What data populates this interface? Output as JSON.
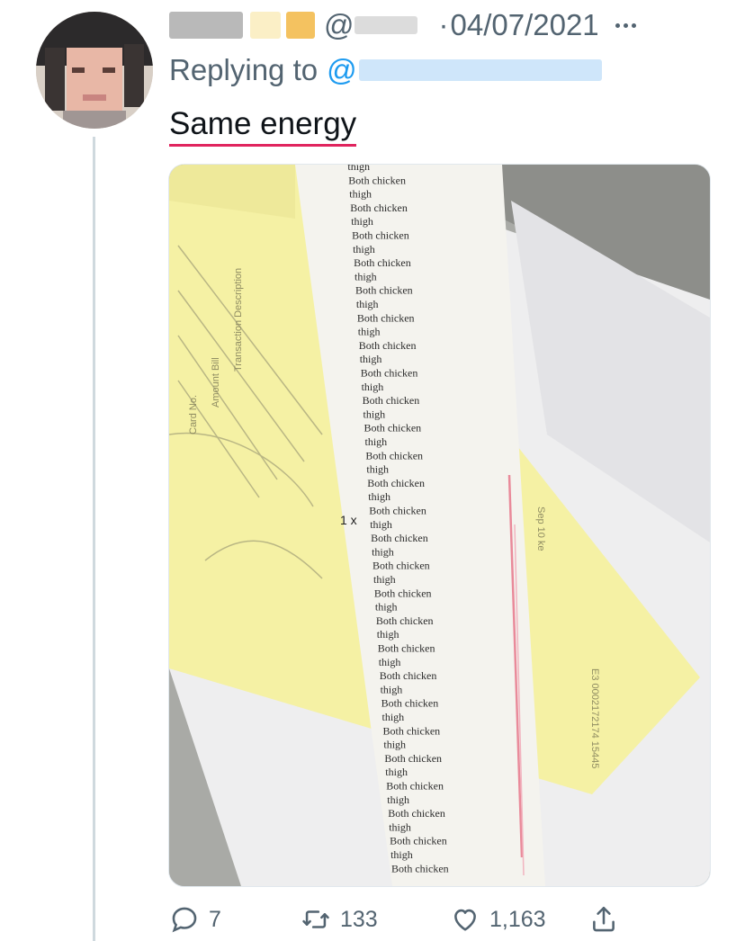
{
  "tweet": {
    "handle_prefix": "@",
    "separator": "·",
    "date": "04/07/2021",
    "replying_to_label": "Replying to",
    "mention_prefix": "@",
    "text": "Same energy"
  },
  "media": {
    "receipt_qty": "1 x",
    "receipt_line_a": "Both chicken",
    "receipt_line_b": "thigh"
  },
  "actions": {
    "reply_count": "7",
    "retweet_count": "133",
    "like_count": "1,163"
  },
  "colors": {
    "text_primary": "#0f1419",
    "text_secondary": "#536471",
    "link": "#1d9bf0",
    "thread_line": "#cfd9de",
    "underline": "#e0245e"
  },
  "icons": [
    "more-icon",
    "reply-icon",
    "retweet-icon",
    "like-icon",
    "share-icon"
  ]
}
